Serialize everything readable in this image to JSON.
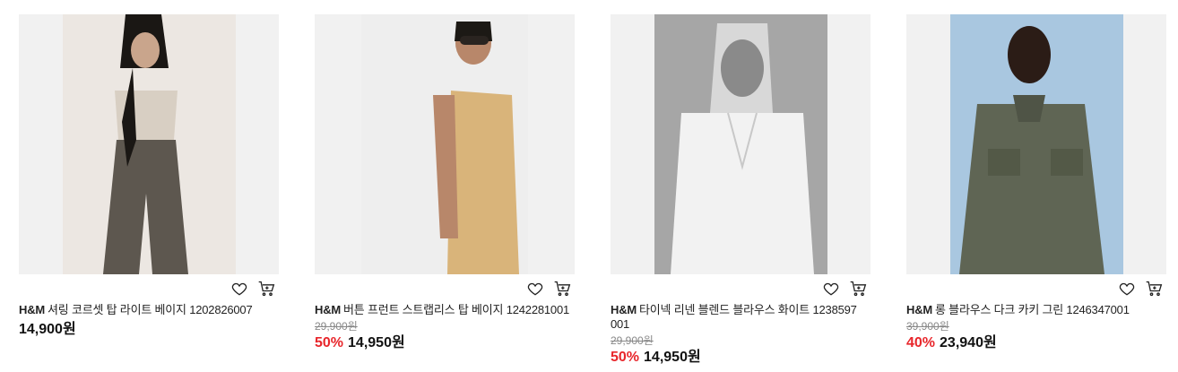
{
  "products": [
    {
      "brand": "H&M",
      "name": "셔링 코르셋 탑 라이트 베이지 1202826007",
      "original_price": "",
      "discount": "",
      "price": "14,900원"
    },
    {
      "brand": "H&M",
      "name": "버튼 프런트 스트랩리스 탑 베이지 1242281001",
      "original_price": "29,900원",
      "discount": "50%",
      "price": "14,950원"
    },
    {
      "brand": "H&M",
      "name": "타이넥 리넨 블렌드 블라우스 화이트 1238597001",
      "original_price": "29,900원",
      "discount": "50%",
      "price": "14,950원"
    },
    {
      "brand": "H&M",
      "name": "롱 블라우스 다크 카키 그린 1246347001",
      "original_price": "39,900원",
      "discount": "40%",
      "price": "23,940원"
    }
  ],
  "icons": {
    "wishlist": "heart-icon",
    "cart": "cart-icon"
  },
  "colors": {
    "discount": "#e8262b",
    "image_bg": "#f1f1f1"
  }
}
